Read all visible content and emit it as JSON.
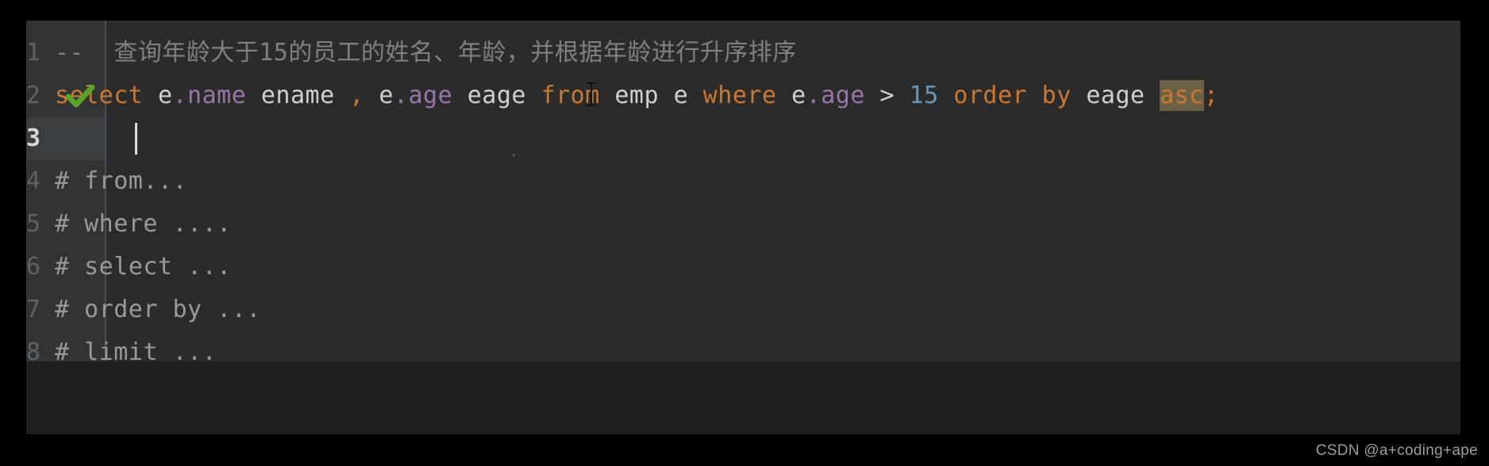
{
  "editor": {
    "current_line": 3,
    "gutter_marker": {
      "line": 2,
      "icon": "green-check-icon"
    },
    "colors": {
      "background": "#2b2b2b",
      "gutter": "#313335",
      "keyword": "#cc7832",
      "identifier": "#d0d0d0",
      "field": "#9876aa",
      "number": "#6897bb",
      "comment": "#808080",
      "highlight": "#6b6144",
      "current_line": "#323232"
    },
    "lines": [
      {
        "number": "1",
        "kind": "sql-comment",
        "text": "--  查询年龄大于15的员工的姓名、年龄，并根据年龄进行升序排序",
        "tokens": [
          {
            "t": "--  查询年龄大于15的员工的姓名、年龄，并根据年龄进行升序排序",
            "c": "comment"
          }
        ]
      },
      {
        "number": "2",
        "kind": "sql",
        "text": "select e.name ename , e.age eage from emp e where e.age > 15 order by eage asc;",
        "tokens": [
          {
            "t": "select",
            "c": "kw"
          },
          {
            "t": " ",
            "c": "ident"
          },
          {
            "t": "e",
            "c": "ident"
          },
          {
            "t": ".name",
            "c": "field"
          },
          {
            "t": " ename ",
            "c": "ident"
          },
          {
            "t": ",",
            "c": "punct"
          },
          {
            "t": " ",
            "c": "ident"
          },
          {
            "t": "e",
            "c": "ident"
          },
          {
            "t": ".age",
            "c": "field"
          },
          {
            "t": " eage ",
            "c": "ident"
          },
          {
            "t": "from",
            "c": "kw"
          },
          {
            "t": " emp e ",
            "c": "ident"
          },
          {
            "t": "where",
            "c": "kw"
          },
          {
            "t": " ",
            "c": "ident"
          },
          {
            "t": "e",
            "c": "ident"
          },
          {
            "t": ".age",
            "c": "field"
          },
          {
            "t": " ",
            "c": "ident"
          },
          {
            "t": ">",
            "c": "op"
          },
          {
            "t": " ",
            "c": "ident"
          },
          {
            "t": "15",
            "c": "num"
          },
          {
            "t": " ",
            "c": "ident"
          },
          {
            "t": "order by",
            "c": "kw"
          },
          {
            "t": " eage ",
            "c": "ident"
          },
          {
            "t": "asc",
            "c": "hl-asc"
          },
          {
            "t": ";",
            "c": "punct"
          }
        ]
      },
      {
        "number": "3",
        "kind": "empty",
        "text": "",
        "tokens": []
      },
      {
        "number": "4",
        "kind": "hash-comment",
        "text": "# from...",
        "tokens": [
          {
            "t": "# from...",
            "c": "hash-comment"
          }
        ]
      },
      {
        "number": "5",
        "kind": "hash-comment",
        "text": "# where ....",
        "tokens": [
          {
            "t": "# where ....",
            "c": "hash-comment"
          }
        ]
      },
      {
        "number": "6",
        "kind": "hash-comment",
        "text": "# select ...",
        "tokens": [
          {
            "t": "# select ...",
            "c": "hash-comment"
          }
        ]
      },
      {
        "number": "7",
        "kind": "hash-comment",
        "text": "# order by ...",
        "tokens": [
          {
            "t": "# order by ...",
            "c": "hash-comment"
          }
        ]
      },
      {
        "number": "8",
        "kind": "hash-comment",
        "text": "# limit ...",
        "tokens": [
          {
            "t": "# limit ...",
            "c": "hash-comment"
          }
        ]
      }
    ]
  },
  "watermark": {
    "text": "CSDN @a+coding+ape"
  }
}
